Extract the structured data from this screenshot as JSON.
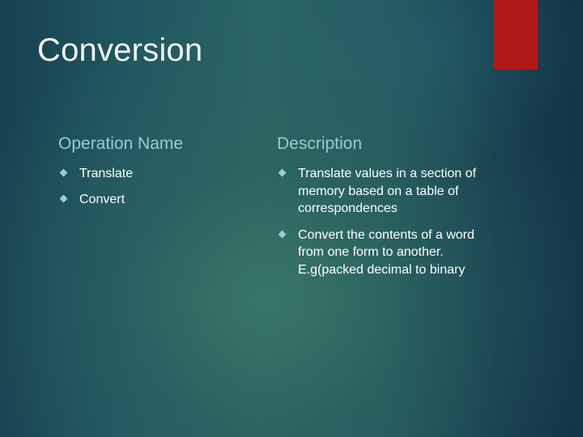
{
  "slide": {
    "title": "Conversion",
    "accent_color": "#b01818",
    "columns": [
      {
        "header": "Operation Name",
        "items": [
          "Translate",
          "Convert"
        ]
      },
      {
        "header": "Description",
        "items": [
          "Translate values in a section of memory based on a table of correspondences",
          "Convert the contents of a word from one form to another. E.g(packed decimal to binary"
        ]
      }
    ],
    "bullet_icon": "diamond-bullet-icon"
  }
}
